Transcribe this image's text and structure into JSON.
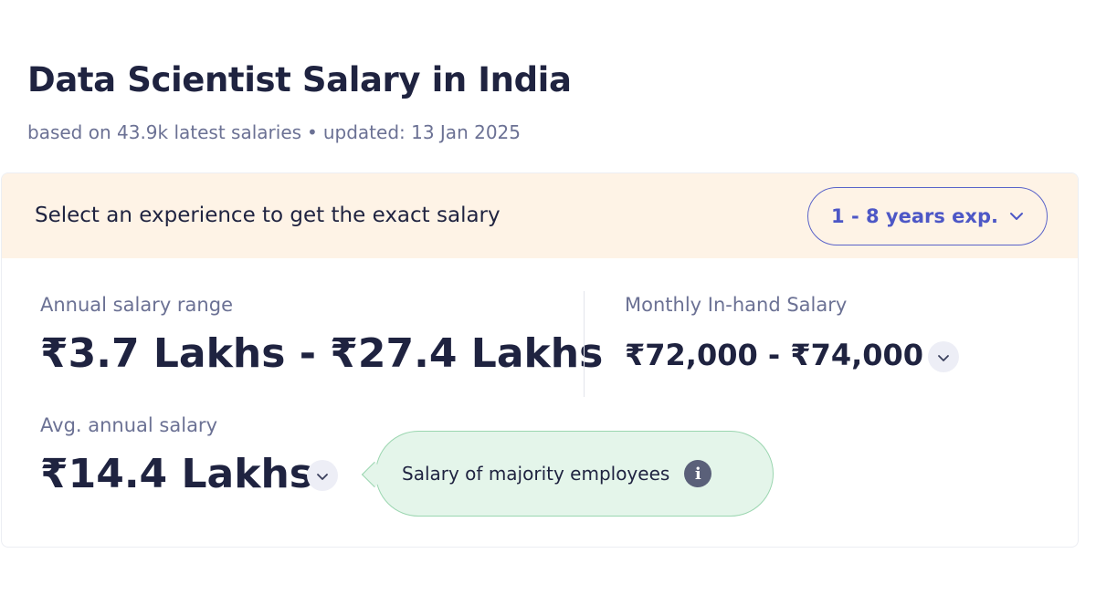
{
  "header": {
    "title": "Data Scientist Salary in India",
    "subtitle_count": "based on 43.9k latest salaries",
    "subtitle_separator": "•",
    "subtitle_updated": "updated: 13 Jan 2025"
  },
  "banner": {
    "text": "Select an experience to get the exact salary",
    "experience_select": "1 - 8 years exp."
  },
  "annual_range": {
    "label": "Annual salary range",
    "value": "₹3.7 Lakhs - ₹27.4 Lakhs"
  },
  "monthly": {
    "label": "Monthly In-hand Salary",
    "value": "₹72,000 - ₹74,000"
  },
  "average": {
    "label": "Avg. annual salary",
    "value": "₹14.4 Lakhs"
  },
  "tooltip": {
    "text": "Salary of majority employees",
    "icon_glyph": "i"
  },
  "colors": {
    "banner_bg": "#fef3e6",
    "accent": "#4d57c6",
    "tooltip_bg": "#e4f5ea",
    "text_primary": "#1f2340",
    "text_secondary": "#6b7194"
  }
}
